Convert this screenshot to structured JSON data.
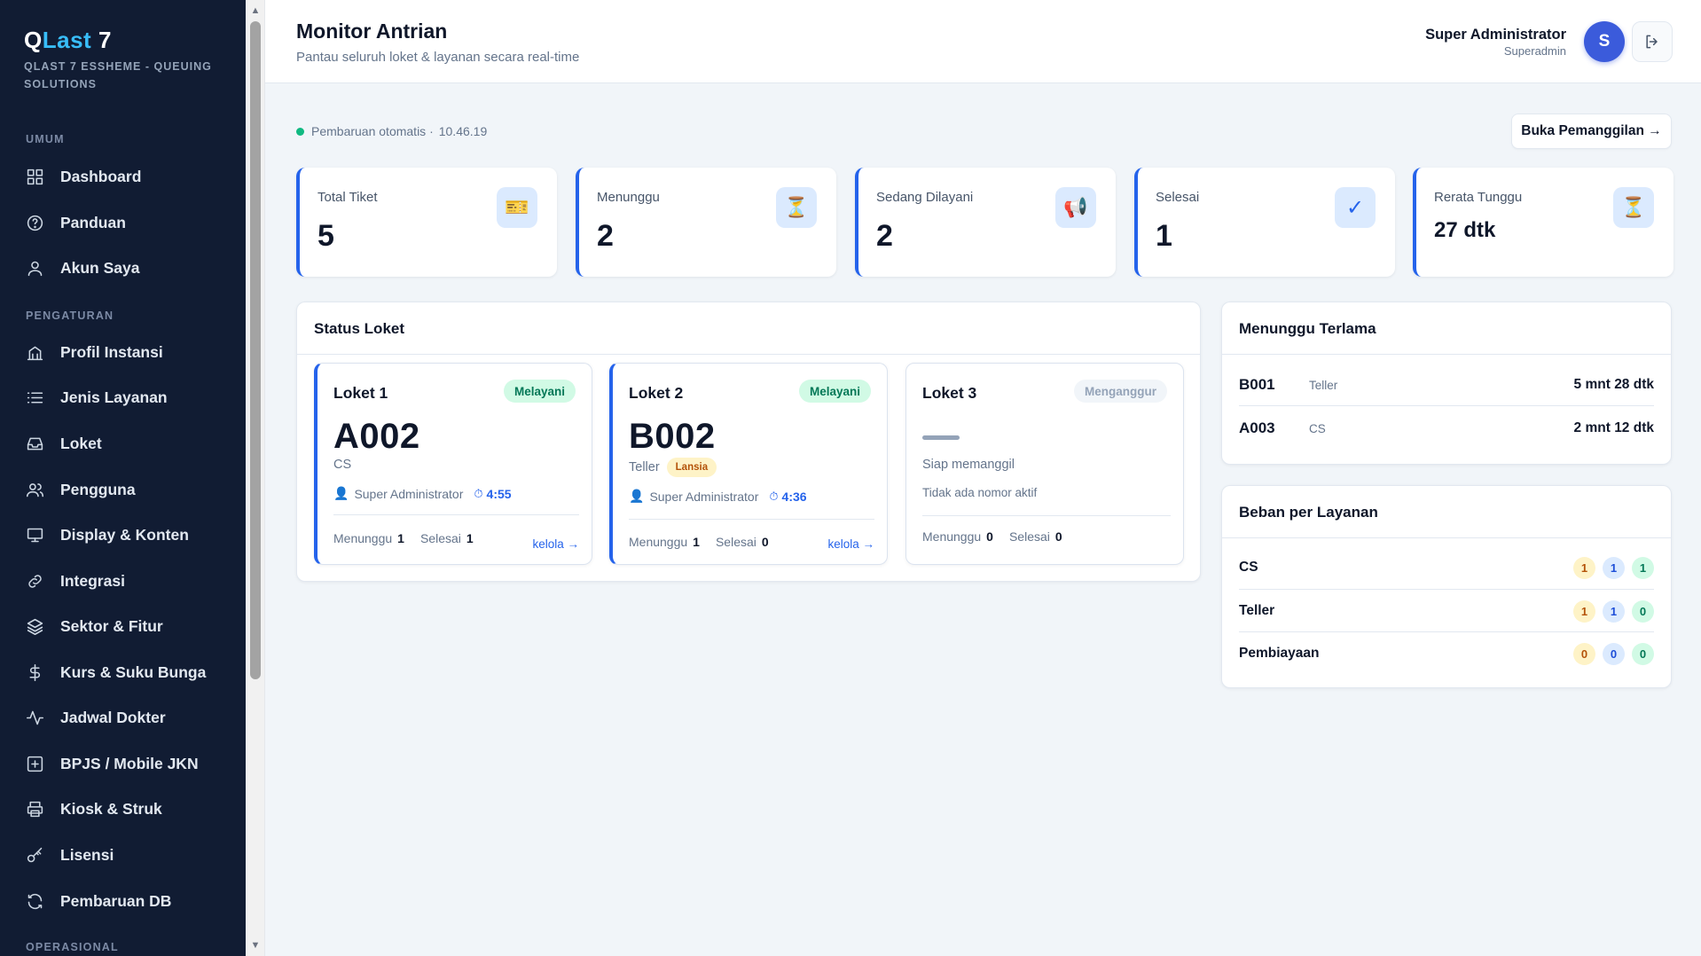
{
  "brand": {
    "q": "Q",
    "last": "Last",
    "version": "7",
    "subtitle": "QLAST 7 ESSHEME - QUEUING SOLUTIONS"
  },
  "sidebar": {
    "sections": [
      "UMUM",
      "PENGATURAN",
      "OPERASIONAL"
    ],
    "items": [
      {
        "label": "Dashboard",
        "icon": "grid-icon"
      },
      {
        "label": "Panduan",
        "icon": "help-circle-icon"
      },
      {
        "label": "Akun Saya",
        "icon": "user-icon"
      },
      {
        "label": "Profil Instansi",
        "icon": "building-icon"
      },
      {
        "label": "Jenis Layanan",
        "icon": "list-icon"
      },
      {
        "label": "Loket",
        "icon": "inbox-icon"
      },
      {
        "label": "Pengguna",
        "icon": "users-icon"
      },
      {
        "label": "Display & Konten",
        "icon": "monitor-icon"
      },
      {
        "label": "Integrasi",
        "icon": "link-icon"
      },
      {
        "label": "Sektor & Fitur",
        "icon": "layers-icon"
      },
      {
        "label": "Kurs & Suku Bunga",
        "icon": "dollar-icon"
      },
      {
        "label": "Jadwal Dokter",
        "icon": "activity-icon"
      },
      {
        "label": "BPJS / Mobile JKN",
        "icon": "plus-square-icon"
      },
      {
        "label": "Kiosk & Struk",
        "icon": "printer-icon"
      },
      {
        "label": "Lisensi",
        "icon": "key-icon"
      },
      {
        "label": "Pembaruan DB",
        "icon": "refresh-icon"
      }
    ]
  },
  "header": {
    "title": "Monitor Antrian",
    "subtitle": "Pantau seluruh loket & layanan secara real-time",
    "user_name": "Super Administrator",
    "user_role": "Superadmin",
    "avatar_initial": "S"
  },
  "toolbar": {
    "auto_update": "Pembaruan otomatis ·",
    "time": "10.46.19",
    "open_button": "Buka Pemanggilan →"
  },
  "stats": [
    {
      "label": "Total Tiket",
      "value": "5",
      "icon": "ticket-icon",
      "glyph": "🎫"
    },
    {
      "label": "Menunggu",
      "value": "2",
      "icon": "hourglass-icon",
      "glyph": "⏳"
    },
    {
      "label": "Sedang Dilayani",
      "value": "2",
      "icon": "megaphone-icon",
      "glyph": "📢"
    },
    {
      "label": "Selesai",
      "value": "1",
      "icon": "check-icon",
      "glyph": "✓"
    },
    {
      "label": "Rerata Tunggu",
      "value": "27 dtk",
      "icon": "hourglass-icon",
      "glyph": "⏳"
    }
  ],
  "status_loket": {
    "title": "Status Loket",
    "cards": [
      {
        "name": "Loket 1",
        "status": "Melayani",
        "number": "A002",
        "service": "CS",
        "operator": "Super Administrator",
        "timer": "4:55",
        "waiting_label": "Menunggu",
        "waiting": "1",
        "done_label": "Selesai",
        "done": "1",
        "manage": "kelola →"
      },
      {
        "name": "Loket 2",
        "status": "Melayani",
        "number": "B002",
        "service": "Teller",
        "tag": "Lansia",
        "operator": "Super Administrator",
        "timer": "4:36",
        "waiting_label": "Menunggu",
        "waiting": "1",
        "done_label": "Selesai",
        "done": "0",
        "manage": "kelola →"
      },
      {
        "name": "Loket 3",
        "status": "Menganggur",
        "ready": "Siap memanggil",
        "inactive": "Tidak ada nomor aktif",
        "waiting_label": "Menunggu",
        "waiting": "0",
        "done_label": "Selesai",
        "done": "0"
      }
    ]
  },
  "longest_wait": {
    "title": "Menunggu Terlama",
    "rows": [
      {
        "number": "B001",
        "service": "Teller",
        "time": "5 mnt 28 dtk"
      },
      {
        "number": "A003",
        "service": "CS",
        "time": "2 mnt 12 dtk"
      }
    ]
  },
  "load_per_service": {
    "title": "Beban per Layanan",
    "rows": [
      {
        "name": "CS",
        "waiting": "1",
        "serving": "1",
        "done": "1"
      },
      {
        "name": "Teller",
        "waiting": "1",
        "serving": "1",
        "done": "0"
      },
      {
        "name": "Pembiayaan",
        "waiting": "0",
        "serving": "0",
        "done": "0"
      }
    ]
  },
  "colors": {
    "sidebar": "#111c33",
    "accent": "#2563eb",
    "brand_accent": "#38bdf8",
    "success": "#10b981"
  }
}
